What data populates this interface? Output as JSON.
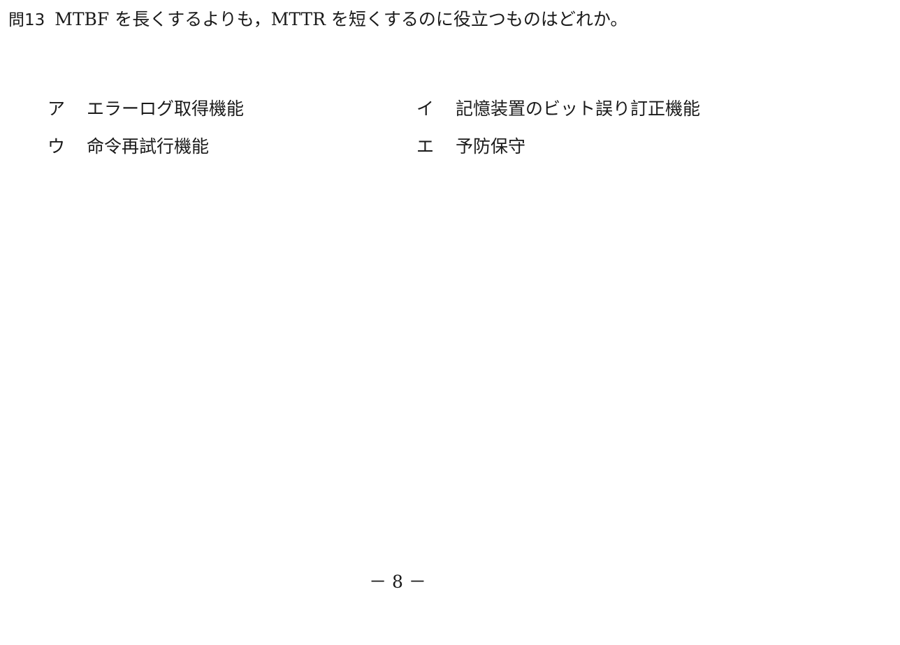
{
  "question": {
    "number": "問13",
    "text": "MTBF を長くするよりも，MTTR を短くするのに役立つものはどれか。"
  },
  "choices": [
    {
      "letter": "ア",
      "text": "エラーログ取得機能"
    },
    {
      "letter": "イ",
      "text": "記憶装置のビット誤り訂正機能"
    },
    {
      "letter": "ウ",
      "text": "命令再試行機能"
    },
    {
      "letter": "エ",
      "text": "予防保守"
    }
  ],
  "page_number": "－ 8 －"
}
